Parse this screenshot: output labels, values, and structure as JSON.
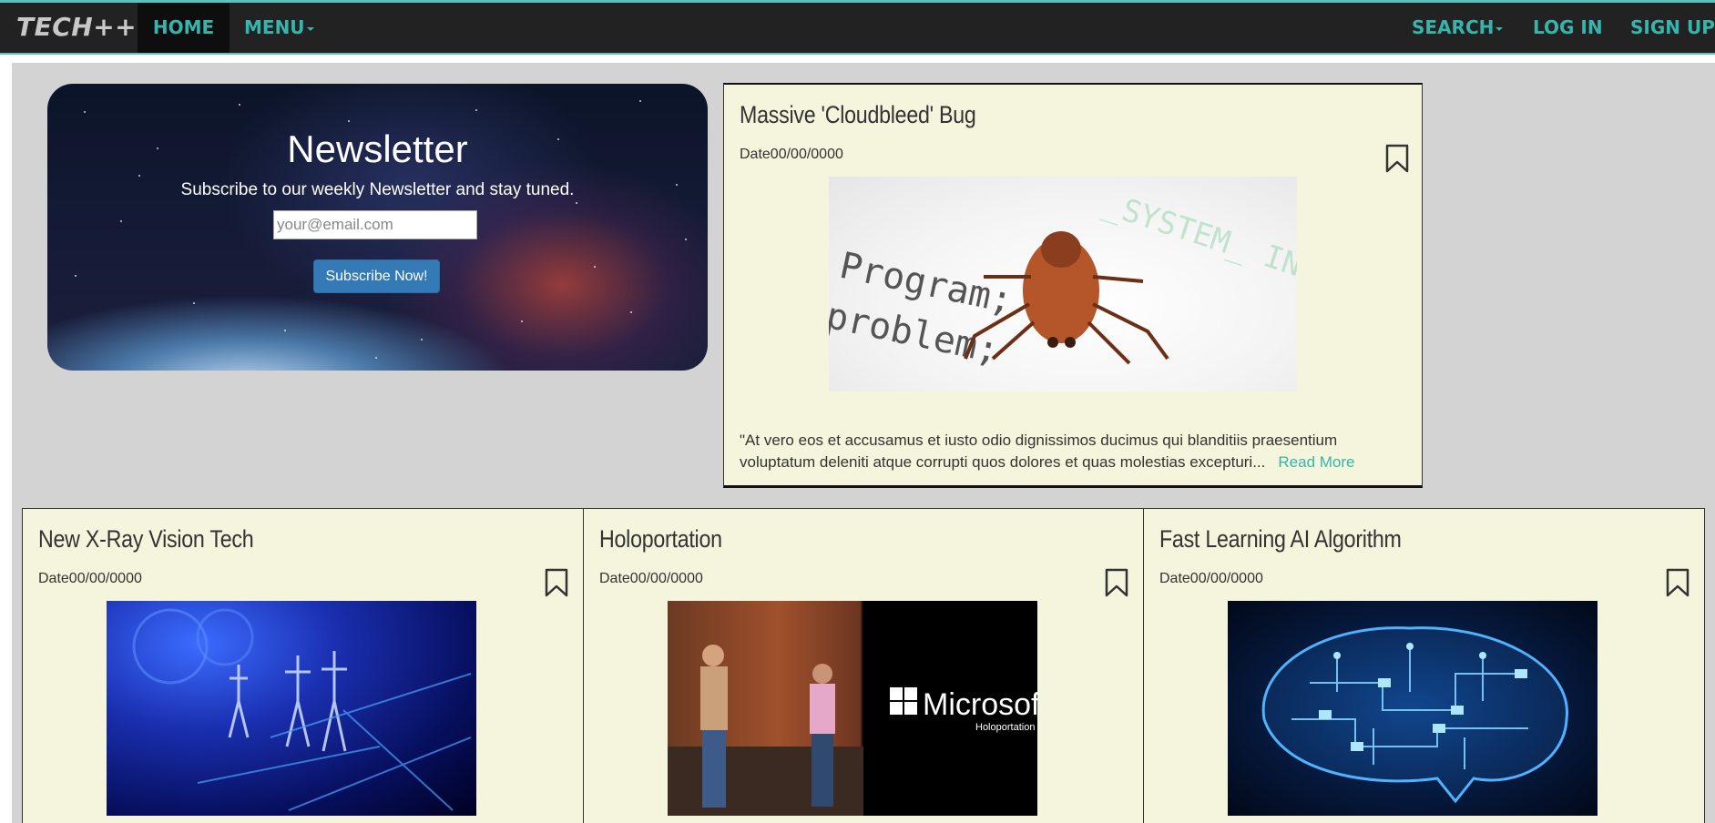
{
  "navbar": {
    "brand": "TECH++",
    "home": "HOME",
    "menu": "MENU",
    "search": "SEARCH",
    "login": "LOG IN",
    "signup": "SIGN UP"
  },
  "newsletter": {
    "title": "Newsletter",
    "subtitle": "Subscribe to our weekly Newsletter and stay tuned.",
    "email_placeholder": "your@email.com",
    "button": "Subscribe Now!"
  },
  "featured": {
    "title": "Massive 'Cloudbleed' Bug",
    "date": "Date00/00/0000",
    "excerpt_line1": "\"At vero eos et accusamus et iusto odio dignissimos ducimus qui blanditiis praesentium",
    "excerpt_line2": "voluptatum deleniti atque corrupti quos dolores et quas molestias excepturi...",
    "read_more": "Read More",
    "image_text": [
      "Program;",
      "problem;"
    ]
  },
  "articles": [
    {
      "title": "New X-Ray Vision Tech",
      "date": "Date00/00/0000"
    },
    {
      "title": "Holoportation",
      "date": "Date00/00/0000",
      "image_text": [
        "Microsoft",
        "Holoportation"
      ]
    },
    {
      "title": "Fast Learning AI Algorithm",
      "date": "Date00/00/0000"
    }
  ],
  "colors": {
    "nav_bg": "#222222",
    "nav_accent": "#36b5ad",
    "card_bg": "#f5f4dc",
    "page_bg": "#d3d3d3",
    "button_blue": "#337ab7"
  }
}
